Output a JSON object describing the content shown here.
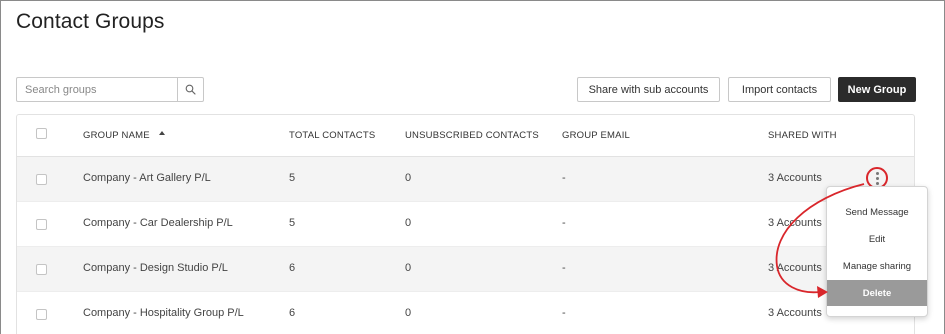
{
  "page": {
    "title": "Contact Groups"
  },
  "toolbar": {
    "search_placeholder": "Search groups",
    "share_label": "Share with sub accounts",
    "import_label": "Import contacts",
    "new_label": "New Group"
  },
  "table": {
    "columns": {
      "name": "GROUP NAME",
      "total": "TOTAL CONTACTS",
      "unsubscribed": "UNSUBSCRIBED CONTACTS",
      "email": "GROUP EMAIL",
      "shared": "SHARED WITH"
    },
    "sort_indicator": "ascending",
    "rows": [
      {
        "name": "Company - Art Gallery P/L",
        "total": "5",
        "unsubscribed": "0",
        "email": "-",
        "shared": "3 Accounts"
      },
      {
        "name": "Company - Car Dealership P/L",
        "total": "5",
        "unsubscribed": "0",
        "email": "-",
        "shared": "3 Accounts"
      },
      {
        "name": "Company - Design Studio P/L",
        "total": "6",
        "unsubscribed": "0",
        "email": "-",
        "shared": "3 Accounts"
      },
      {
        "name": "Company - Hospitality Group P/L",
        "total": "6",
        "unsubscribed": "0",
        "email": "-",
        "shared": "3 Accounts"
      }
    ]
  },
  "menu": {
    "items": [
      "Send Message",
      "Edit",
      "Manage sharing",
      "Delete"
    ],
    "highlighted": "Delete"
  },
  "colors": {
    "primary_button": "#2b2b2b",
    "annotation_red": "#d9262b",
    "row_alt": "#f4f4f4",
    "menu_highlight": "#9a9a9a"
  },
  "icons": {
    "search": "search-icon",
    "sort": "sort-ascending-icon",
    "row_actions": "kebab-menu-icon"
  }
}
